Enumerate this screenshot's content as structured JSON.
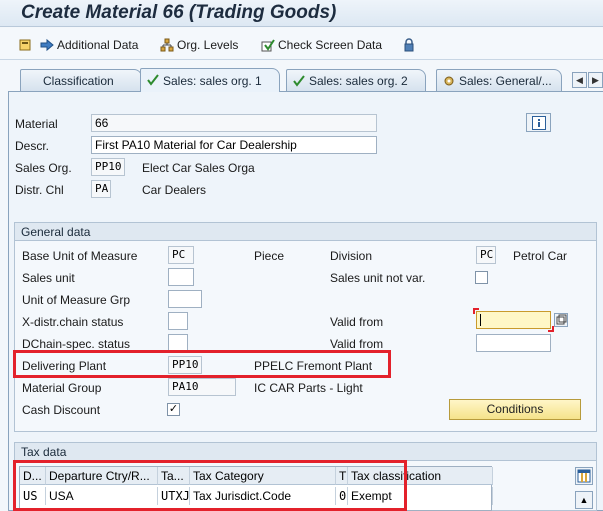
{
  "window": {
    "title": "Create Material 66 (Trading Goods)"
  },
  "toolbar": {
    "additional_data": "Additional Data",
    "org_levels": "Org. Levels",
    "check_screen_data": "Check Screen Data"
  },
  "tabs": [
    {
      "label": "Classification"
    },
    {
      "label": "Sales: sales org. 1"
    },
    {
      "label": "Sales: sales org. 2"
    },
    {
      "label": "Sales: General/..."
    }
  ],
  "header": {
    "material_label": "Material",
    "material_value": "66",
    "descr_label": "Descr.",
    "descr_value": "First PA10 Material for Car Dealership",
    "sales_org_label": "Sales Org.",
    "sales_org_value": "PP10",
    "sales_org_text": "Elect Car Sales Orga",
    "distr_chl_label": "Distr. Chl",
    "distr_chl_value": "PA",
    "distr_chl_text": "Car Dealers"
  },
  "general": {
    "title": "General data",
    "base_uom_label": "Base Unit of Measure",
    "base_uom_value": "PC",
    "base_uom_text": "Piece",
    "division_label": "Division",
    "division_value": "PC",
    "division_text": "Petrol Car",
    "sales_unit_label": "Sales unit",
    "sales_unit_not_var_label": "Sales unit not var.",
    "uom_group_label": "Unit of Measure Grp",
    "xdistr_label": "X-distr.chain status",
    "valid_from_label_1": "Valid from",
    "dchain_label": "DChain-spec. status",
    "valid_from_label_2": "Valid from",
    "delivering_plant_label": "Delivering Plant",
    "delivering_plant_value": "PP10",
    "delivering_plant_text": "PPELC Fremont Plant",
    "material_group_label": "Material Group",
    "material_group_value": "PA10",
    "material_group_text": "IC CAR Parts - Light",
    "cash_discount_label": "Cash Discount",
    "cash_discount_checked": "✓",
    "conditions_button": "Conditions"
  },
  "tax": {
    "title": "Tax data",
    "columns": [
      "D...",
      "Departure Ctry/R...",
      "Ta...",
      "Tax Category",
      "T",
      "Tax classification"
    ],
    "rows": [
      [
        "US",
        "USA",
        "UTXJ",
        "Tax Jurisdict.Code",
        "0",
        "Exempt"
      ]
    ]
  }
}
